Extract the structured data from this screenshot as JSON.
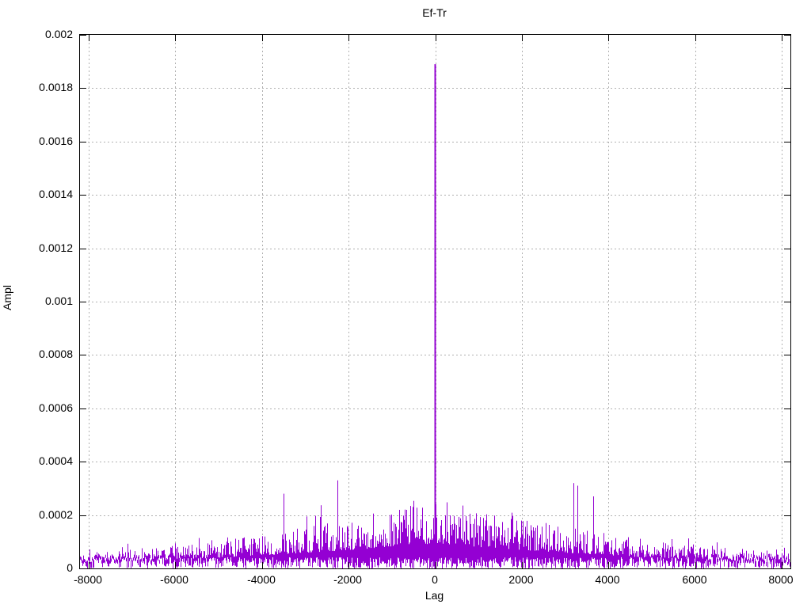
{
  "title": "Ef-Tr",
  "axis": {
    "x_label": "Lag",
    "y_label": "Ampl"
  },
  "colors": {
    "series": "#9400d3",
    "grid": "#b0b0b0",
    "border": "#000000",
    "background": "#ffffff",
    "text": "#000000"
  },
  "chart_data": {
    "type": "line",
    "title": "Ef-Tr",
    "xlabel": "Lag",
    "ylabel": "Ampl",
    "xlim": [
      -8192,
      8192
    ],
    "ylim": [
      0,
      0.002
    ],
    "grid": true,
    "legend": false,
    "xticks": [
      -8000,
      -6000,
      -4000,
      -2000,
      0,
      2000,
      4000,
      6000,
      8000
    ],
    "xtick_labels": [
      "-8000",
      "-6000",
      "-4000",
      "-2000",
      "0",
      "2000",
      "4000",
      "6000",
      "8000"
    ],
    "yticks": [
      0,
      0.0002,
      0.0004,
      0.0006,
      0.0008,
      0.001,
      0.0012,
      0.0014,
      0.0016,
      0.0018,
      0.002
    ],
    "ytick_labels": [
      "0",
      "0.0002",
      "0.0004",
      "0.0006",
      "0.0008",
      "0.001",
      "0.0012",
      "0.0014",
      "0.0016",
      "0.0018",
      "0.002"
    ],
    "main_peak": {
      "lag": 0,
      "ampl": 0.00189
    },
    "notable_peaks": [
      {
        "lag": -3500,
        "ampl": 0.00028
      },
      {
        "lag": -2250,
        "ampl": 0.00033
      },
      {
        "lag": 3185,
        "ampl": 0.00032
      },
      {
        "lag": 3280,
        "ampl": 0.00031
      },
      {
        "lag": 3650,
        "ampl": 0.00027
      }
    ],
    "noise_floor": {
      "edge_typical_ampl": 6e-05,
      "center_typical_ampl": 0.0002,
      "center_max_ampl": 0.00035,
      "shape": "amplitude rises smoothly from both edges toward lag 0 (triangular correlation envelope)"
    },
    "noise_model": {
      "seed": 1337,
      "env_base": 4.5e-05,
      "env_scale": 0.00014,
      "env_power": 1.45,
      "max_coeffs": [
        0.5,
        0.85,
        2.2,
        0.65,
        9
      ],
      "lo_prob": 0.3,
      "vmin_lo_max": 1.2e-05,
      "vmin_hi_base": 1.6e-05,
      "vmin_hi_span": 2.6e-05,
      "min_bar": 1.2e-05
    }
  }
}
